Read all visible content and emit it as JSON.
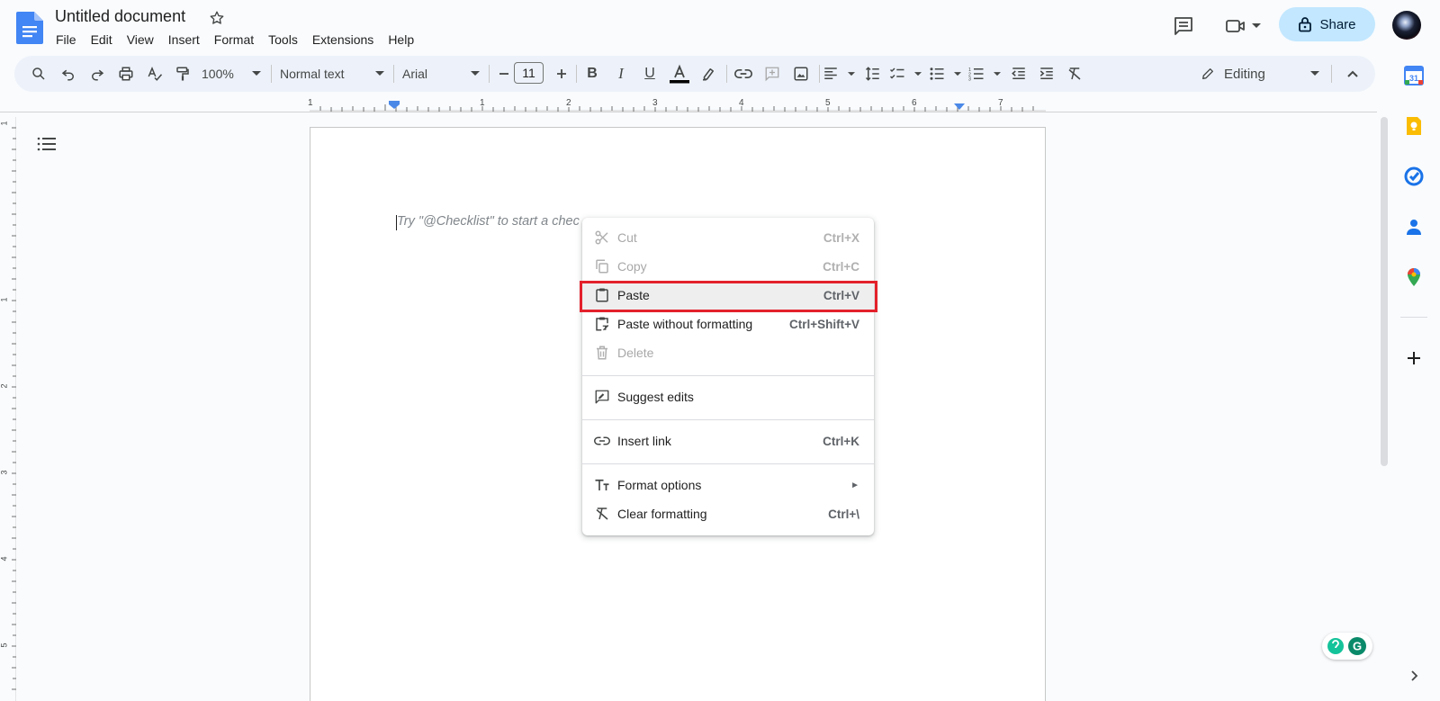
{
  "document": {
    "title": "Untitled document",
    "placeholder": "Try \"@Checklist\" to start a chec"
  },
  "menubar": [
    "File",
    "Edit",
    "View",
    "Insert",
    "Format",
    "Tools",
    "Extensions",
    "Help"
  ],
  "header": {
    "share_label": "Share"
  },
  "toolbar": {
    "zoom": "100%",
    "style": "Normal text",
    "font": "Arial",
    "font_size": "11",
    "mode": "Editing"
  },
  "ruler": {
    "h_labels": [
      "1",
      "1",
      "2",
      "3",
      "4",
      "5",
      "6",
      "7"
    ],
    "v_labels": [
      "1",
      "1",
      "2",
      "3",
      "4",
      "5"
    ]
  },
  "context_menu": {
    "items": [
      {
        "label": "Cut",
        "shortcut": "Ctrl+X",
        "icon": "scissors-icon",
        "disabled": true
      },
      {
        "label": "Copy",
        "shortcut": "Ctrl+C",
        "icon": "copy-icon",
        "disabled": true
      },
      {
        "label": "Paste",
        "shortcut": "Ctrl+V",
        "icon": "clipboard-icon",
        "highlighted": true
      },
      {
        "label": "Paste without formatting",
        "shortcut": "Ctrl+Shift+V",
        "icon": "paste-plain-icon"
      },
      {
        "label": "Delete",
        "shortcut": "",
        "icon": "trash-icon",
        "disabled": true
      },
      {
        "label": "Suggest edits",
        "shortcut": "",
        "icon": "suggest-edits-icon"
      },
      {
        "label": "Insert link",
        "shortcut": "Ctrl+K",
        "icon": "link-icon"
      },
      {
        "label": "Format options",
        "shortcut": "►",
        "icon": "format-text-icon"
      },
      {
        "label": "Clear formatting",
        "shortcut": "Ctrl+\\",
        "icon": "clear-format-icon"
      }
    ]
  },
  "colors": {
    "accent": "#c2e7ff",
    "highlight_border": "#e3212b",
    "toolbar_bg": "#edf2fa"
  }
}
